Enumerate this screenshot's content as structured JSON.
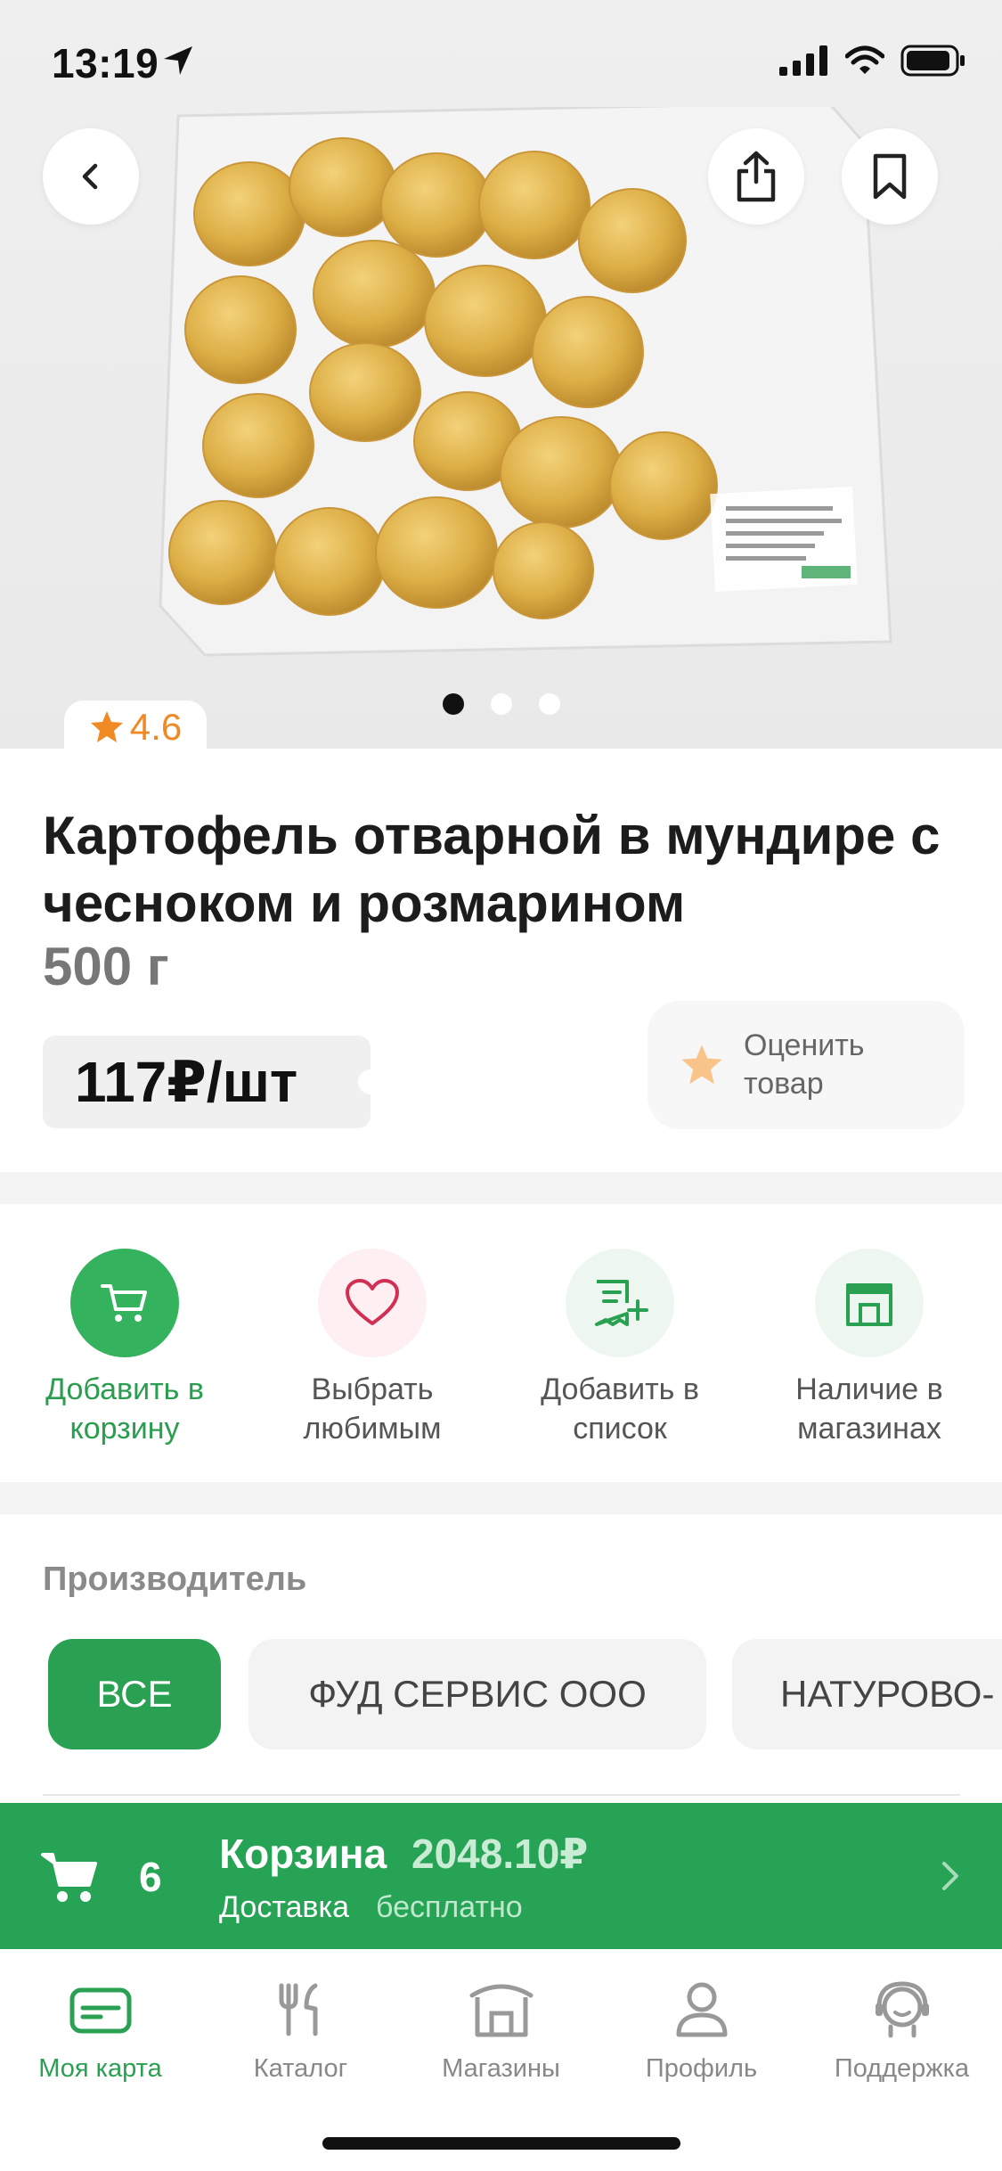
{
  "status": {
    "time": "13:19"
  },
  "colors": {
    "accent": "#27a356",
    "rating_star": "#f08a24",
    "favorite": "#d22f54"
  },
  "gallery": {
    "slides": 3,
    "active_slide": 1
  },
  "product": {
    "rating": "4.6",
    "title": "Картофель отварной в мундире с чесноком и розмарином",
    "weight": "500 г",
    "price": "117₽/шт",
    "rate_label": "Оценить товар"
  },
  "actions": [
    {
      "label": "Добавить в корзину",
      "icon": "cart-icon"
    },
    {
      "label": "Выбрать любимым",
      "icon": "heart-icon"
    },
    {
      "label": "Добавить в список",
      "icon": "list-add-icon"
    },
    {
      "label": "Наличие в магазинах",
      "icon": "store-icon"
    }
  ],
  "manufacturer": {
    "title": "Производитель",
    "chips": [
      "ВСЕ",
      "ФУД СЕРВИС ООО",
      "НАТУРОВО-"
    ],
    "selected": "ВСЕ"
  },
  "cart": {
    "count": "6",
    "label": "Корзина",
    "total": "2048.10₽",
    "delivery_label": "Доставка",
    "delivery_value": "бесплатно"
  },
  "tabs": [
    {
      "label": "Моя карта",
      "icon": "card-icon",
      "active": true
    },
    {
      "label": "Каталог",
      "icon": "fork-knife-icon",
      "active": false
    },
    {
      "label": "Магазины",
      "icon": "store-icon",
      "active": false
    },
    {
      "label": "Профиль",
      "icon": "profile-icon",
      "active": false
    },
    {
      "label": "Поддержка",
      "icon": "support-icon",
      "active": false
    }
  ]
}
